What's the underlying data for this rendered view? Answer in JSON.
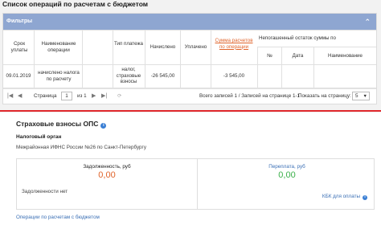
{
  "page_title": "Список операций по расчетам с бюджетом",
  "filter_bar": {
    "label": "Фильтры",
    "toggle_icon": "chevron-up-icon"
  },
  "table": {
    "headers": {
      "due_date": "Срок уплаты",
      "operation_name": "Наименование операции",
      "payment_type": "Тип платежа",
      "charged": "Начислено",
      "paid": "Уплачено",
      "sum_by_operation": "Сумма расчетов по операции",
      "unpaid_balance": "Непогашенный остаток суммы по",
      "num": "№",
      "date": "Дата",
      "name": "Наименование"
    },
    "rows": [
      {
        "due_date": "09.01.2019",
        "operation_name": "начислено налога по расчету",
        "payment_type": "налог, страховые взносы",
        "charged": "-26 545,00",
        "paid": "",
        "sum_by_operation": "-3 545,00",
        "num": "",
        "date": "",
        "name": ""
      }
    ]
  },
  "pager": {
    "page_label": "Страница",
    "page_value": "1",
    "of_label": "из 1",
    "summary": "Всего записей 1 / Записей на странице 1-1",
    "per_page_label": "Показать на страницу:",
    "per_page_value": "5"
  },
  "ops_section": {
    "title": "Страховые взносы ОПС",
    "tax_authority_label": "Налоговый орган",
    "tax_authority_name": "Межрайонная ИФНС России №26 по Санкт-Петербургу",
    "debt_label": "Задолженность, руб",
    "debt_value": "0,00",
    "overpay_label": "Переплата, руб",
    "overpay_value": "0,00",
    "no_debt_text": "Задолженности нет",
    "kbk_link": "КБК для оплаты"
  },
  "bottom_link": "Операции по расчетам с бюджетом",
  "colors": {
    "filter_bar": "#8ea6d1",
    "accent_red": "#e0282c",
    "debt_value": "#e0632a",
    "overpay_value": "#3bb04a",
    "link": "#3a6fb5"
  }
}
